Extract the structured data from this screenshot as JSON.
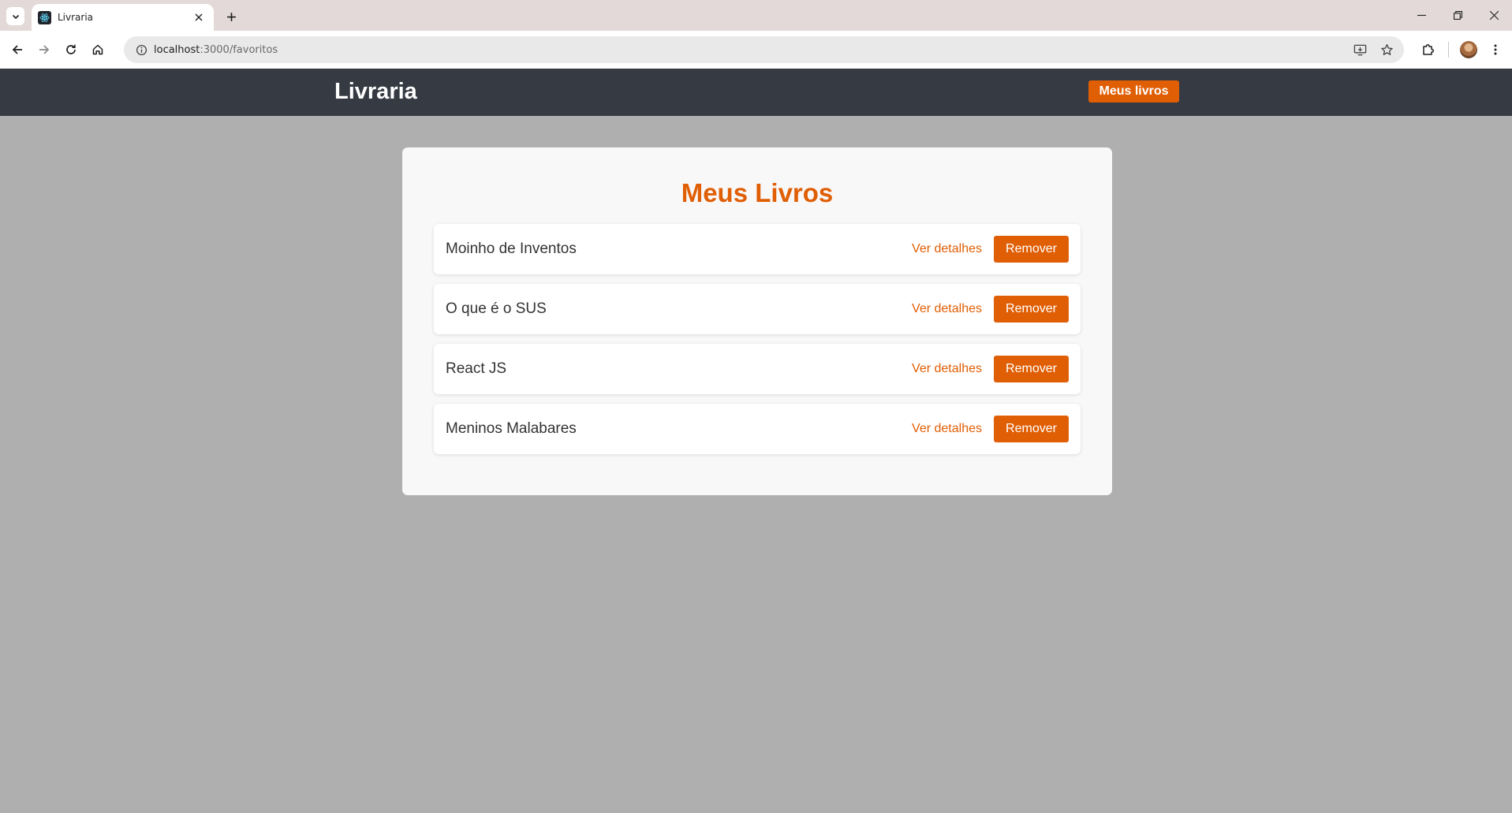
{
  "browser": {
    "tab_title": "Livraria",
    "url_host": "localhost",
    "url_path": ":3000/favoritos"
  },
  "header": {
    "brand": "Livraria",
    "nav_label": "Meus livros"
  },
  "main": {
    "title": "Meus Livros",
    "details_label": "Ver detalhes",
    "remove_label": "Remover",
    "books": [
      {
        "title": "Moinho de Inventos"
      },
      {
        "title": "O que é o SUS"
      },
      {
        "title": "React JS"
      },
      {
        "title": "Meninos Malabares"
      }
    ]
  },
  "colors": {
    "accent": "#e05e04",
    "header_bg": "#353a43",
    "page_bg": "#afafaf",
    "card_bg": "#f8f8f8"
  }
}
